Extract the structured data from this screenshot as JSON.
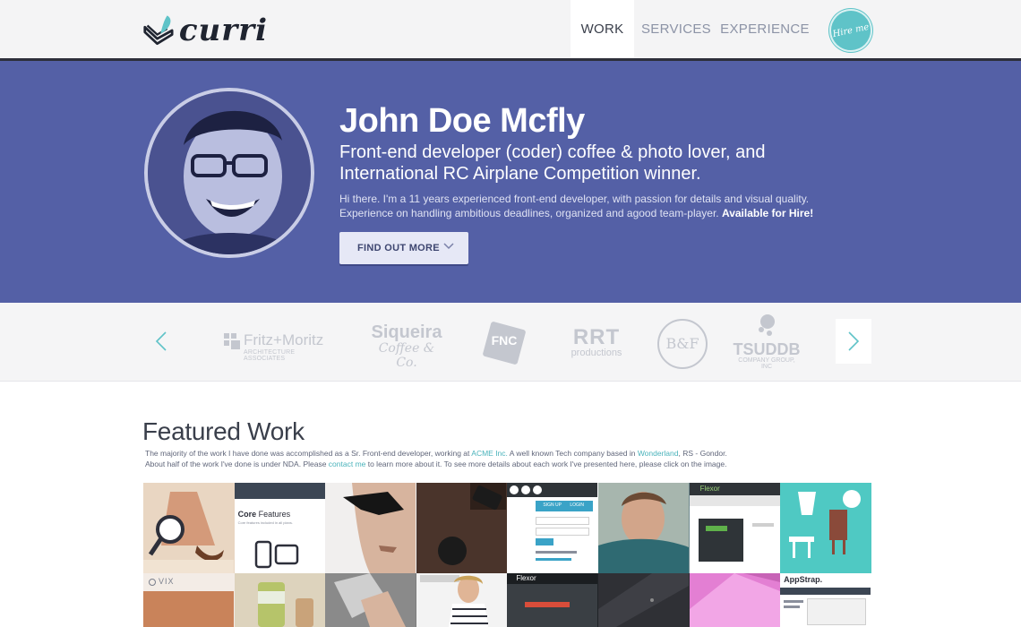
{
  "header": {
    "logo_text": "curri",
    "nav": [
      {
        "label": "WORK",
        "active": true
      },
      {
        "label": "SERVICES",
        "active": false
      },
      {
        "label": "EXPERIENCE",
        "active": false
      }
    ],
    "hire_label": "Hire me"
  },
  "hero": {
    "name": "John Doe Mcfly",
    "tagline": "Front-end developer (coder) coffee & photo lover, and International RC Airplane Competition winner.",
    "description_line1": "Hi there. I'm a 11 years experienced front-end developer, with passion for details and visual quality.",
    "description_line2": "Experience on handling ambitious deadlines, organized and agood team-player.",
    "availability": "Available for Hire!",
    "cta_label": "FIND OUT MORE"
  },
  "clients": [
    {
      "name": "Fritz+Moritz",
      "sub": "ARCHITECTURE ASSOCIATES"
    },
    {
      "name": "Siqueira",
      "sub": "Coffee & Co."
    },
    {
      "name": "FNC",
      "sub": ""
    },
    {
      "name": "RRT",
      "sub": "productions"
    },
    {
      "name": "B&F",
      "sub": ""
    },
    {
      "name": "TSUDDB",
      "sub": "COMPANY GROUP, INC"
    }
  ],
  "featured": {
    "title": "Featured Work",
    "line1_a": "The majority of the work I have done was accomplished as a Sr. Front-end developer, working at ",
    "line1_link1": "ACME Inc.",
    "line1_b": " A well known Tech company based in ",
    "line1_link2": "Wonderland",
    "line1_c": ", RS - Gondor.",
    "line2_a": "About half of the work I've done is under NDA. Please ",
    "line2_link": "contact me",
    "line2_b": " to learn more about it. To see more details about each work I've presented here, please click on the image.",
    "tile_texts": {
      "core_title": "Core",
      "core_title2": " Features",
      "core_sub": "Core features included in all plans.",
      "flexor": "Flexor",
      "appstrap": "AppStrap.",
      "vix": "VIX",
      "signup": "SIGN UP",
      "login": "LOGIN"
    }
  },
  "colors": {
    "hero_bg": "#5460a6",
    "accent": "#5fc3c8",
    "header_bg": "#f4f4f5"
  }
}
